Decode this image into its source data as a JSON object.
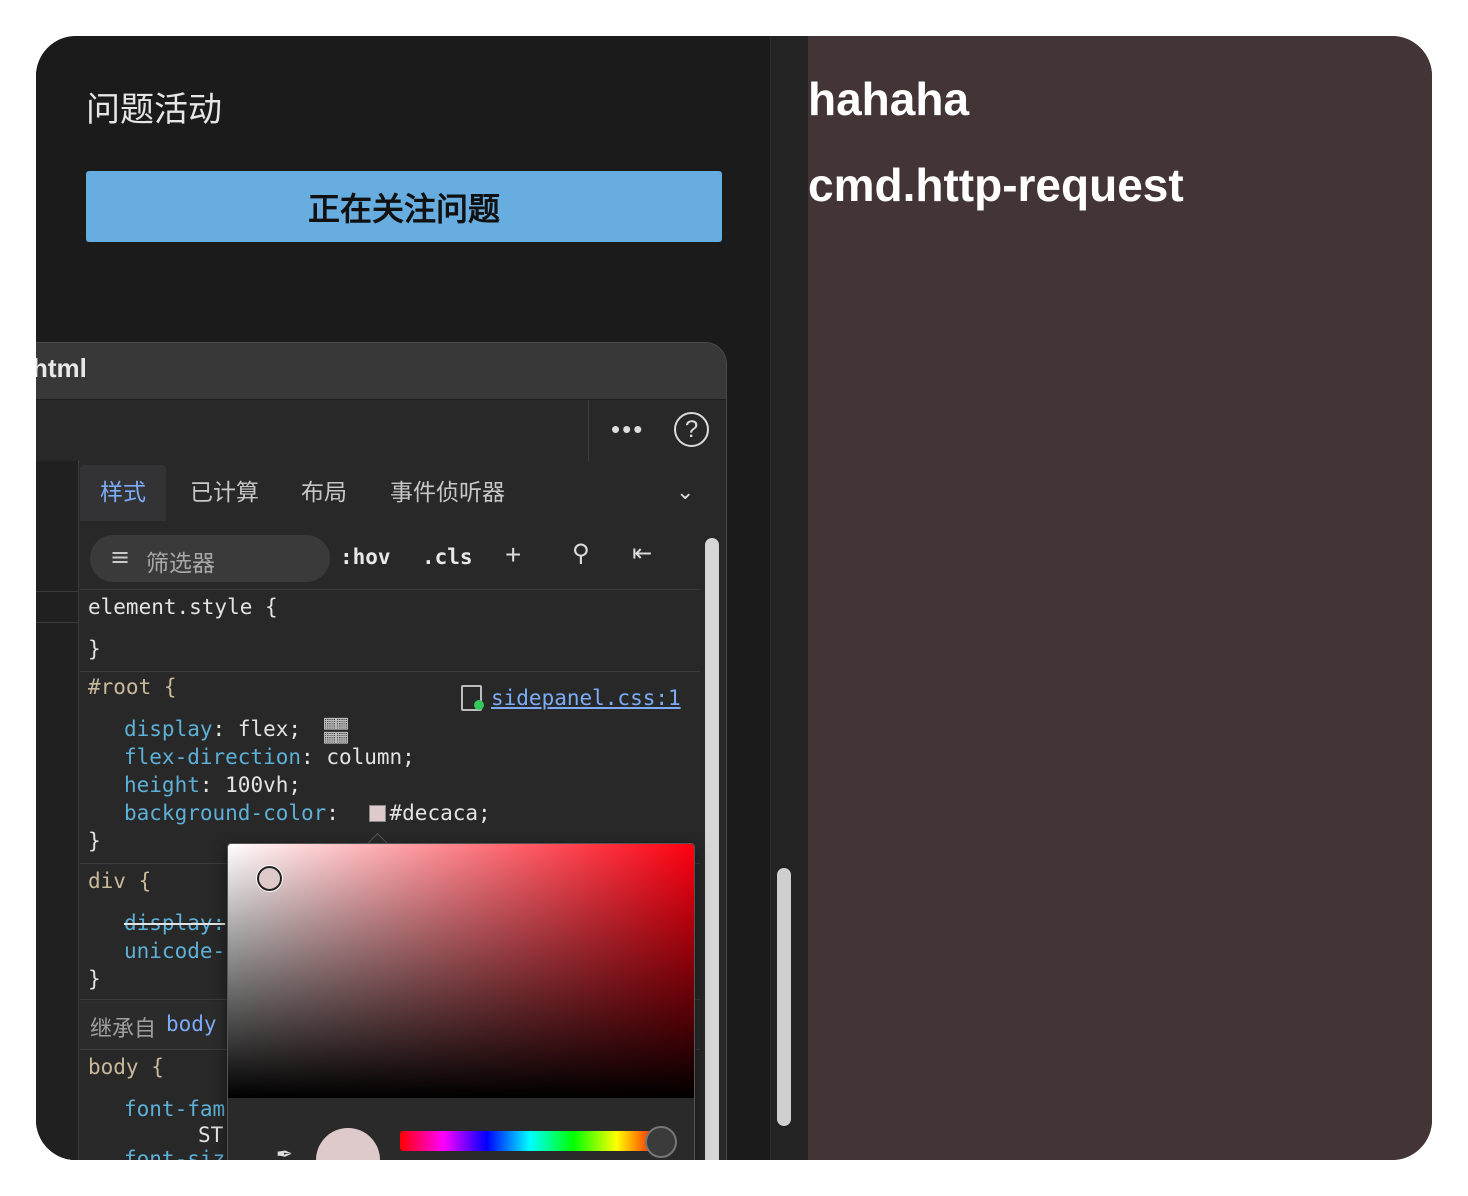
{
  "side_panel": {
    "title": "问题活动",
    "follow_button": "正在关注问题"
  },
  "page_content": {
    "line1": "hahaha",
    "line2": "cmd.http-request",
    "background_color": "#433535"
  },
  "devtools": {
    "title": "html",
    "toolbar": {
      "more_icon": "more-horizontal-icon",
      "help_icon": "help-circle-icon",
      "help_glyph": "?"
    },
    "tabs": [
      "样式",
      "已计算",
      "布局",
      "事件侦听器"
    ],
    "active_tab": "样式",
    "styles_toolbar": {
      "filter_placeholder": "筛选器",
      "hov": ":hov",
      "cls": ".cls"
    },
    "rules": {
      "element_style": {
        "open": "element.style {",
        "close": "}"
      },
      "root": {
        "selector": "#root {",
        "source": "sidepanel.css:1",
        "decls": [
          {
            "prop": "display",
            "value": "flex;"
          },
          {
            "prop": "flex-direction",
            "value": "column;"
          },
          {
            "prop": "height",
            "value": "100vh;"
          },
          {
            "prop": "background-color",
            "value": "#decaca;"
          }
        ],
        "close": "}"
      },
      "div": {
        "selector": "div {",
        "decl1_prop": "display:",
        "decl2_prop": "unicode-",
        "close": "}"
      },
      "inherited_label": "继承自",
      "inherited_from": "body",
      "body": {
        "selector": "body {",
        "decl1_prop": "font-fam",
        "decl1_cont": "ST",
        "decl2_prop": "font-siz"
      }
    },
    "color_picker": {
      "current_color": "#decaca"
    }
  }
}
